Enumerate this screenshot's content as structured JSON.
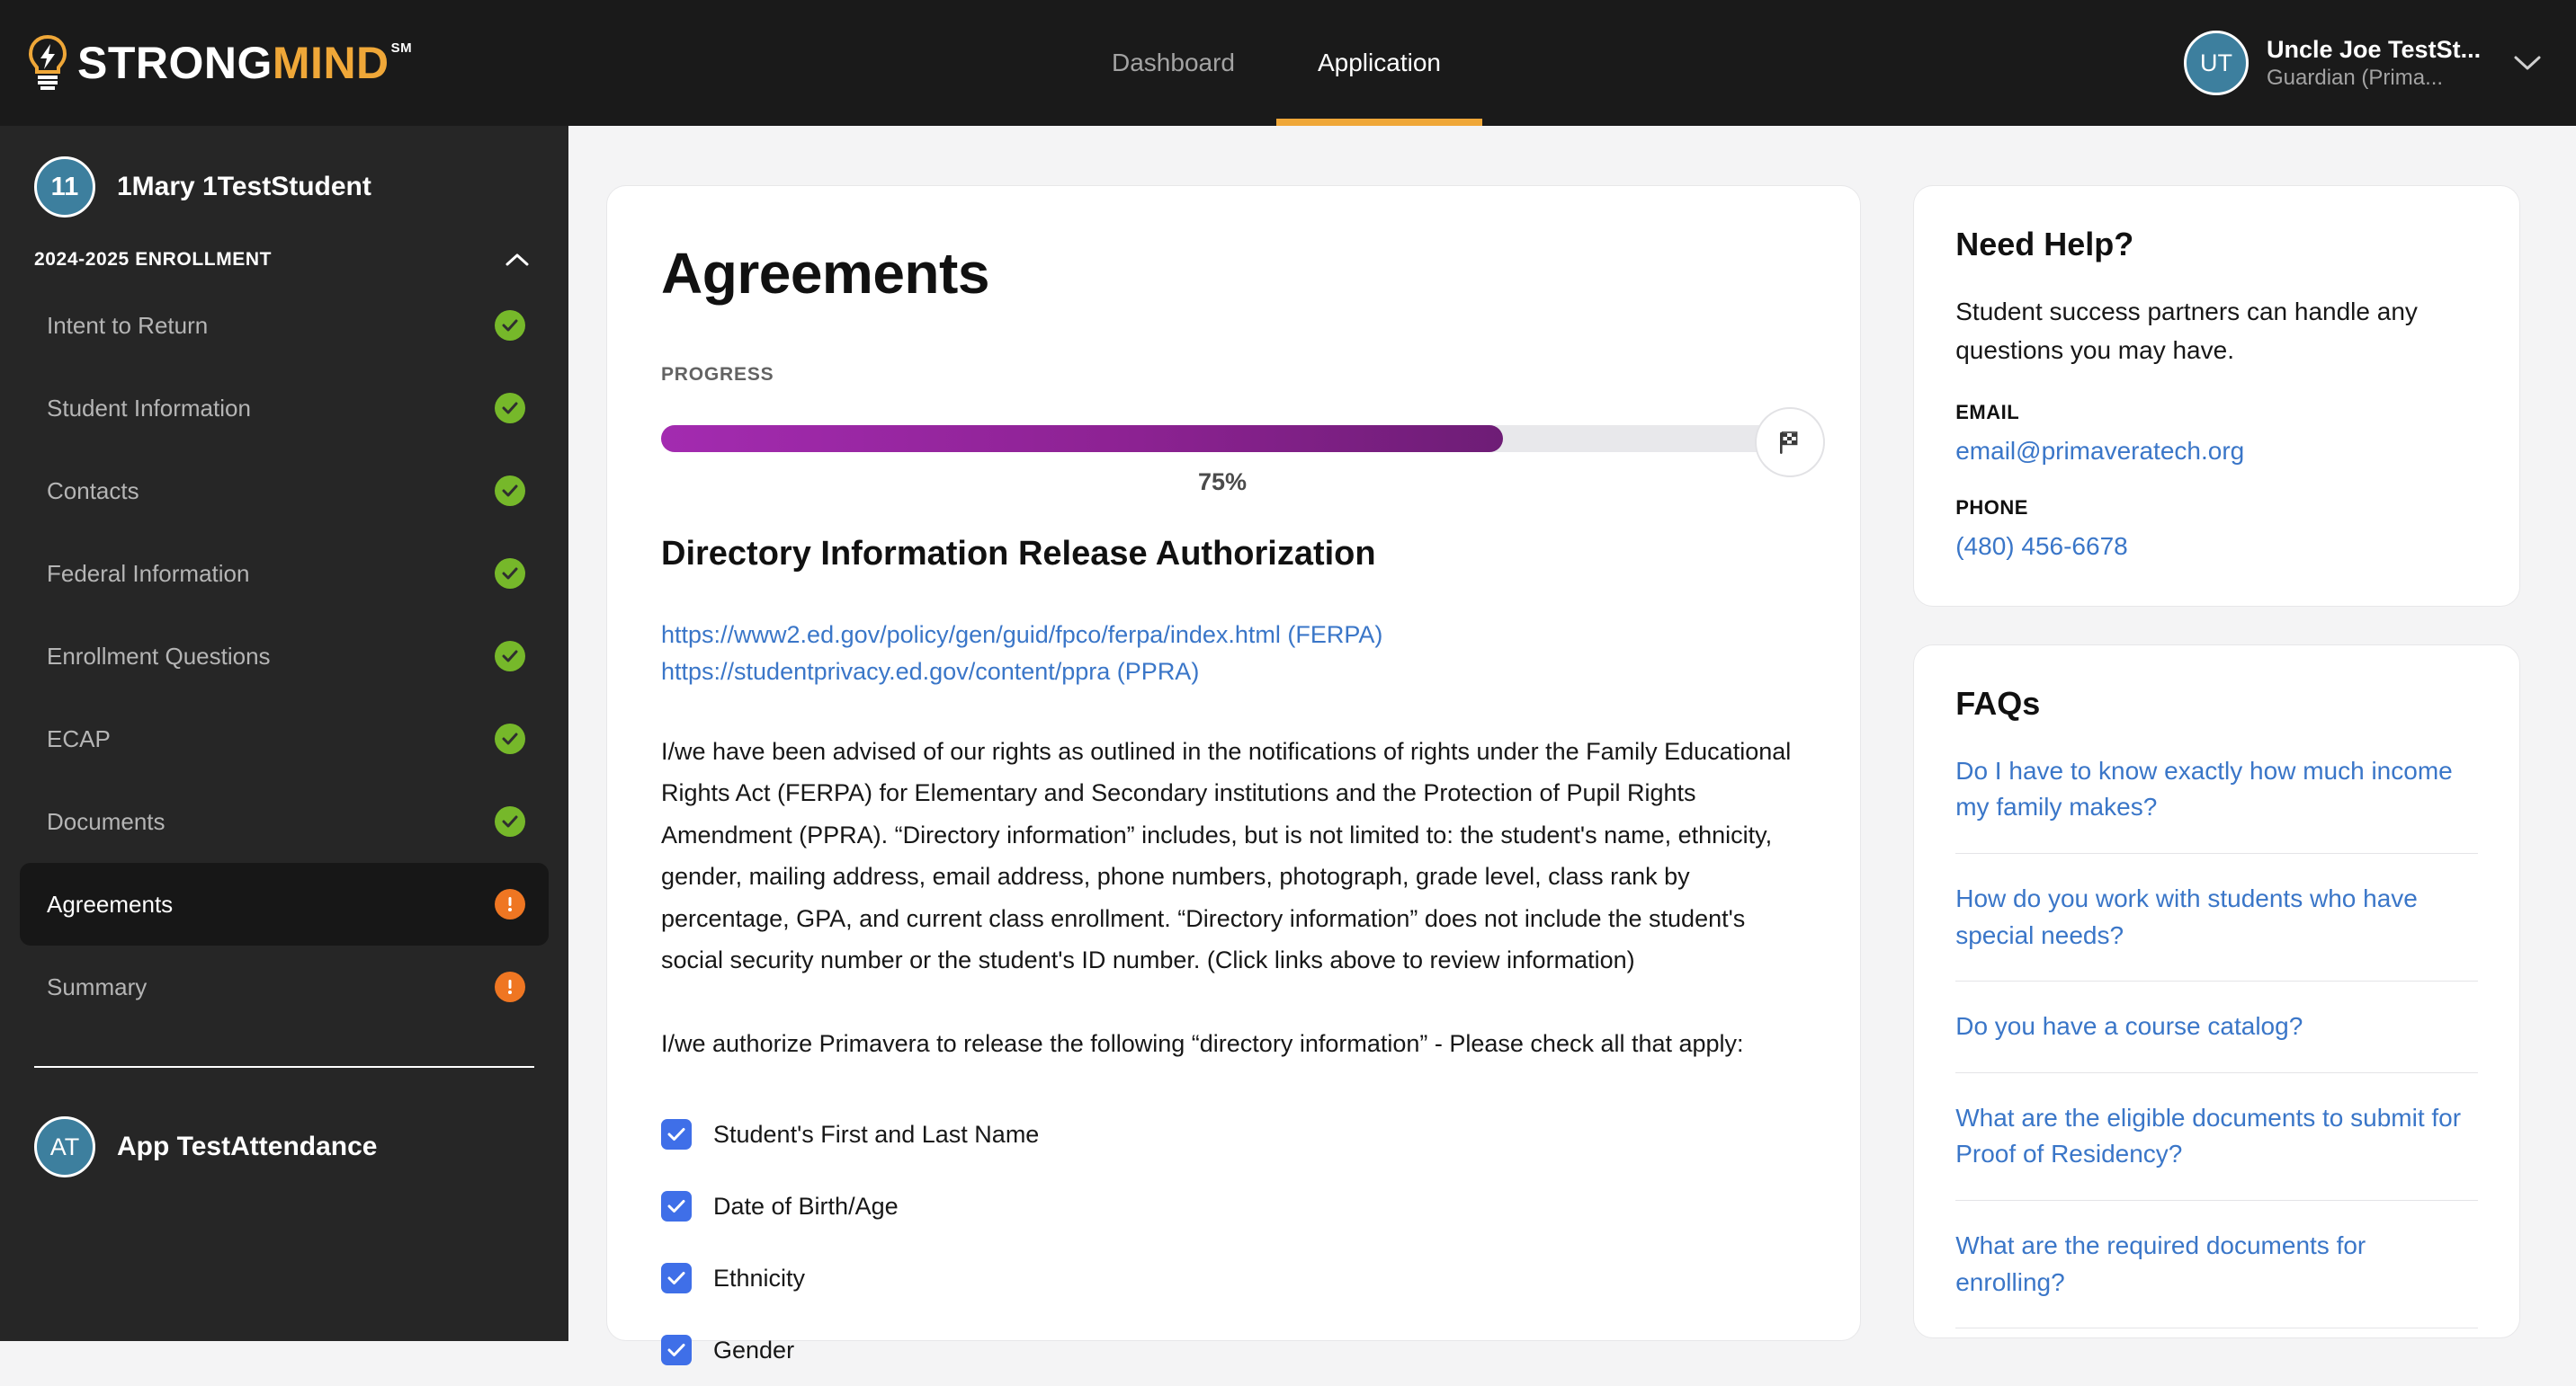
{
  "brand": {
    "name_strong": "STRONG",
    "name_mind": "MIND",
    "sm_mark": "SM"
  },
  "topnav": {
    "items": [
      {
        "label": "Dashboard",
        "active": false
      },
      {
        "label": "Application",
        "active": true
      }
    ]
  },
  "user": {
    "initials": "UT",
    "name": "Uncle Joe TestSt...",
    "role": "Guardian (Prima..."
  },
  "sidebar": {
    "student": {
      "badge": "11",
      "name": "1Mary 1TestStudent"
    },
    "section": {
      "title": "2024-2025 ENROLLMENT",
      "collapse_icon": "chevron-up-icon"
    },
    "items": [
      {
        "label": "Intent to Return",
        "status": "complete",
        "active": false
      },
      {
        "label": "Student Information",
        "status": "complete",
        "active": false
      },
      {
        "label": "Contacts",
        "status": "complete",
        "active": false
      },
      {
        "label": "Federal Information",
        "status": "complete",
        "active": false
      },
      {
        "label": "Enrollment Questions",
        "status": "complete",
        "active": false
      },
      {
        "label": "ECAP",
        "status": "complete",
        "active": false
      },
      {
        "label": "Documents",
        "status": "complete",
        "active": false
      },
      {
        "label": "Agreements",
        "status": "alert",
        "active": true
      },
      {
        "label": "Summary",
        "status": "alert",
        "active": false
      }
    ],
    "footer_user": {
      "initials": "AT",
      "name": "App TestAttendance"
    }
  },
  "main": {
    "page_title": "Agreements",
    "progress_label": "PROGRESS",
    "progress_percent": 75,
    "progress_percent_text": "75%",
    "flag_icon": "checkered-flag-icon",
    "section_heading": "Directory Information Release Authorization",
    "links": [
      "https://www2.ed.gov/policy/gen/guid/fpco/ferpa/index.html (FERPA)",
      "https://studentprivacy.ed.gov/content/ppra (PPRA)"
    ],
    "paragraph": "I/we have been advised of our rights as outlined in the notifications of rights under the Family Educational Rights Act (FERPA) for Elementary and Secondary institutions and the Protection of Pupil Rights Amendment (PPRA). “Directory information” includes, but is not limited to: the student's name, ethnicity, gender, mailing address, email address, phone numbers, photograph, grade level, class rank by percentage, GPA, and current class enrollment. “Directory information” does not include the student's social security number or the student's ID number. (Click links above to review information)",
    "authorize_text": "I/we authorize Primavera to release the following “directory information” - Please check all that apply:",
    "checkboxes": [
      {
        "label": "Student's First and Last Name",
        "checked": true
      },
      {
        "label": "Date of Birth/Age",
        "checked": true
      },
      {
        "label": "Ethnicity",
        "checked": true
      },
      {
        "label": "Gender",
        "checked": true
      }
    ]
  },
  "help": {
    "title": "Need Help?",
    "description": "Student success partners can handle any questions you may have.",
    "email_label": "EMAIL",
    "email": "email@primaveratech.org",
    "phone_label": "PHONE",
    "phone": "(480) 456-6678"
  },
  "faqs": {
    "title": "FAQs",
    "items": [
      "Do I have to know exactly how much income my family makes?",
      "How do you work with students who have special needs?",
      "Do you have a course catalog?",
      "What are the eligible documents to submit for Proof of Residency?",
      "What are the required documents for enrolling?"
    ]
  },
  "colors": {
    "brand_orange": "#efa738",
    "topbar_bg": "#1a1a1a",
    "sidebar_bg": "#262626",
    "accent_link": "#3a76c8",
    "progress_start": "#a32bb0",
    "progress_end": "#6e1d76",
    "status_complete": "#76b82a",
    "status_alert": "#ef7622",
    "checkbox_blue": "#3f6fe8",
    "avatar_teal": "#3d7f9e"
  }
}
